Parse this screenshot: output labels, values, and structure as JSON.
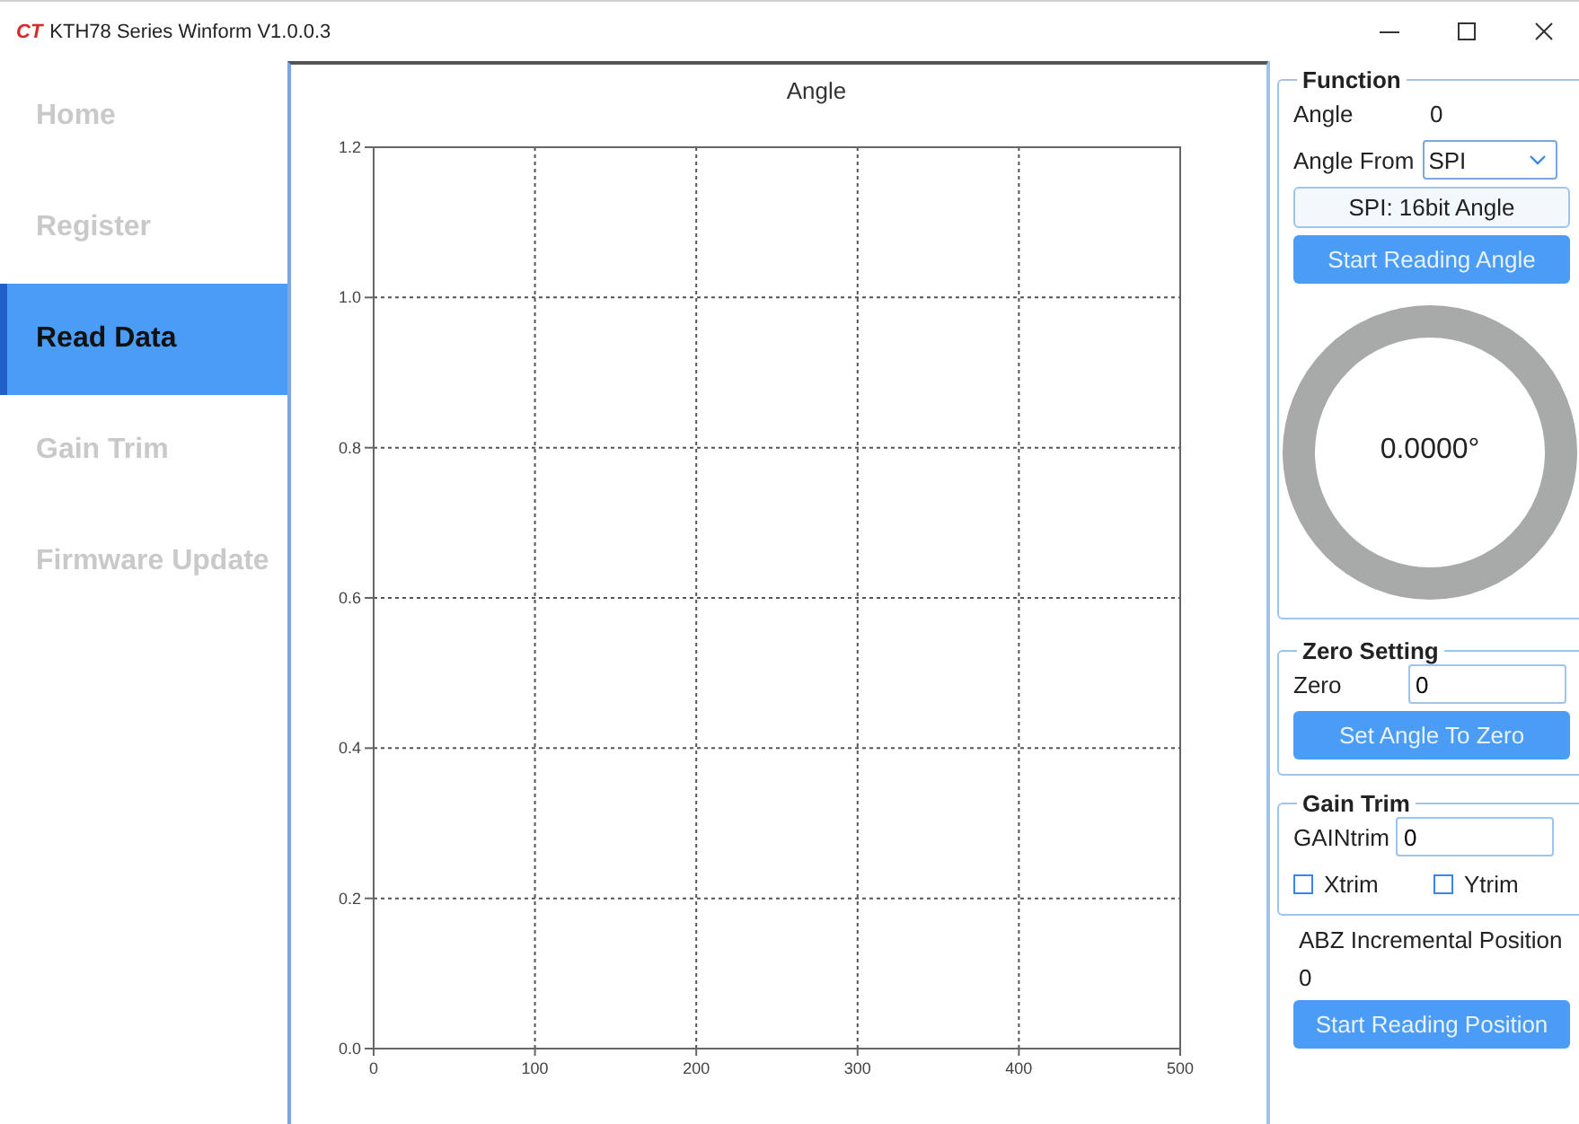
{
  "window": {
    "logo": "CT",
    "title": "KTH78 Series Winform V1.0.0.3"
  },
  "sidebar": {
    "items": [
      {
        "label": "Home",
        "selected": false
      },
      {
        "label": "Register",
        "selected": false
      },
      {
        "label": "Read Data",
        "selected": true
      },
      {
        "label": "Gain Trim",
        "selected": false
      },
      {
        "label": "Firmware Update",
        "selected": false
      }
    ]
  },
  "chart": {
    "chart_data": {
      "type": "line",
      "grid": true,
      "title": "Angle",
      "xlim": [
        0,
        500
      ],
      "ylim": [
        0,
        1.2
      ],
      "xticks": [
        0,
        100,
        200,
        300,
        400,
        500
      ],
      "yticks": [
        {
          "value": 0,
          "label": "0.0"
        },
        {
          "value": 0.2,
          "label": "0.2"
        },
        {
          "value": 0.4,
          "label": "0.4"
        },
        {
          "value": 0.6,
          "label": "0.6"
        },
        {
          "value": 0.8,
          "label": "0.8"
        },
        {
          "value": 1,
          "label": "1.0"
        },
        {
          "value": 1.2,
          "label": "1.2"
        }
      ]
    }
  },
  "function": {
    "legend": "Function",
    "angle_label": "Angle",
    "angle_value": "0",
    "source_label": "Angle From",
    "source_value": "SPI",
    "mode": "SPI: 16bit Angle",
    "start_button": "Start Reading Angle",
    "dial_reading": "0.0000°"
  },
  "zero_setting": {
    "legend": "Zero Setting",
    "zero_label": "Zero",
    "zero_value": "0",
    "button": "Set Angle To Zero"
  },
  "gain_trim": {
    "legend": "Gain Trim",
    "gain_label": "GAINtrim",
    "gain_value": "0",
    "checkboxes": [
      {
        "label": "Xtrim",
        "checked": false
      },
      {
        "label": "Ytrim",
        "checked": false
      }
    ]
  },
  "position": {
    "label": "ABZ Incremental Position",
    "value": "0",
    "button": "Start Reading Position"
  }
}
